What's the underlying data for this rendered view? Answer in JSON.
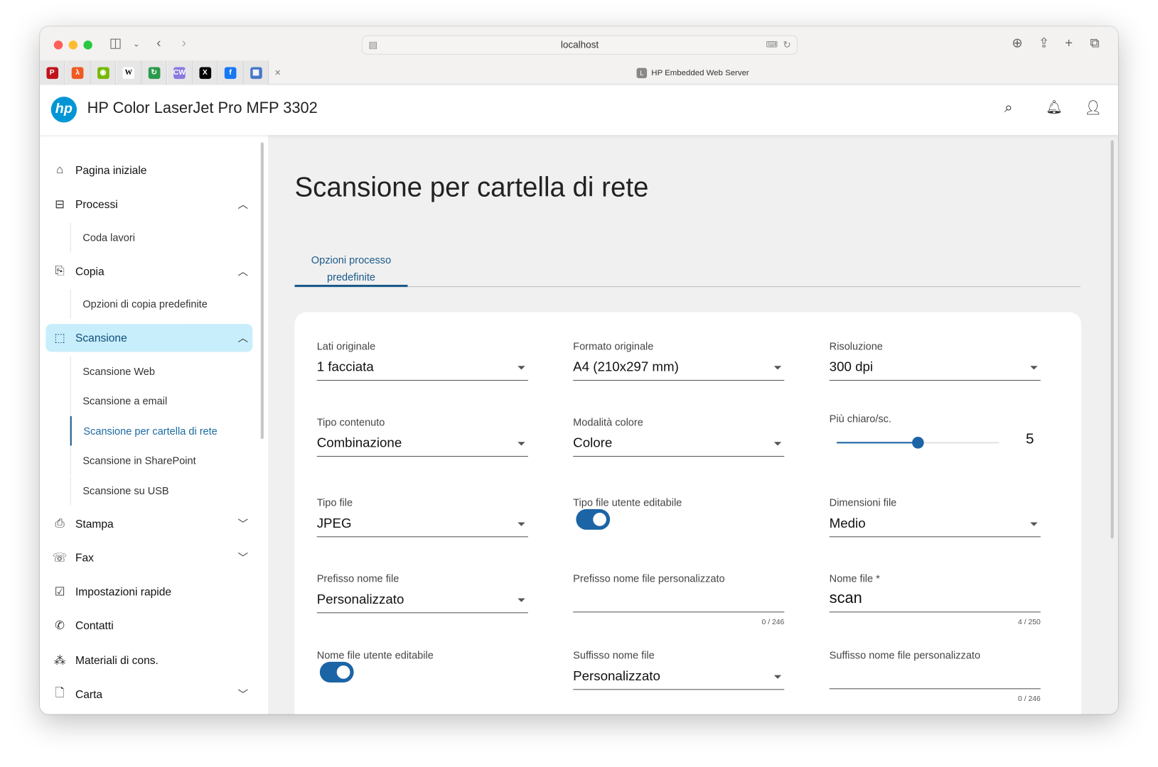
{
  "browser": {
    "url": "localhost",
    "tab_title": "HP Embedded Web Server",
    "tab_favicon_letter": "L",
    "close_label": "×",
    "favorites": [
      {
        "icon": "red-app-icon",
        "color": "#c0141c",
        "glyph": "P"
      },
      {
        "icon": "orange-app-icon",
        "color": "#f05a22",
        "glyph": "λ"
      },
      {
        "icon": "nvidia-icon",
        "color": "#76b900",
        "glyph": "◉"
      },
      {
        "icon": "wikipedia-icon",
        "color": "#ffffff",
        "glyph": "W"
      },
      {
        "icon": "green-red-app-icon",
        "color": "#2b9a4a",
        "glyph": "↻"
      },
      {
        "icon": "cw-icon",
        "color": "#8a7ae0",
        "glyph": "CW"
      },
      {
        "icon": "x-icon",
        "color": "#000000",
        "glyph": "X"
      },
      {
        "icon": "facebook-icon",
        "color": "#1877f2",
        "glyph": "f"
      },
      {
        "icon": "blue-grid-icon",
        "color": "#4a78c8",
        "glyph": "▦"
      }
    ]
  },
  "header": {
    "title": "HP Color LaserJet Pro MFP 3302",
    "logo_text": "hp"
  },
  "sidebar": {
    "home": "Pagina iniziale",
    "processi": "Processi",
    "coda": "Coda lavori",
    "copia": "Copia",
    "copia_opz": "Opzioni di copia predefinite",
    "scansione": "Scansione",
    "scan_items": [
      "Scansione Web",
      "Scansione a email",
      "Scansione per cartella di rete",
      "Scansione in SharePoint",
      "Scansione su USB"
    ],
    "stampa": "Stampa",
    "fax": "Fax",
    "impostazioni": "Impostazioni rapide",
    "contatti": "Contatti",
    "materiali": "Materiali di cons.",
    "carta": "Carta"
  },
  "main": {
    "title": "Scansione per cartella di rete",
    "tab_line1": "Opzioni processo",
    "tab_line2": "predefinite",
    "fields": {
      "lati": {
        "label": "Lati originale",
        "value": "1 facciata"
      },
      "formato": {
        "label": "Formato originale",
        "value": "A4 (210x297 mm)"
      },
      "risoluzione": {
        "label": "Risoluzione",
        "value": "300 dpi"
      },
      "tipo_contenuto": {
        "label": "Tipo contenuto",
        "value": "Combinazione"
      },
      "modalita": {
        "label": "Modalità colore",
        "value": "Colore"
      },
      "chiaro": {
        "label": "Più chiaro/sc.",
        "value": "5",
        "min": 1,
        "max": 9
      },
      "tipo_file": {
        "label": "Tipo file",
        "value": "JPEG"
      },
      "tipo_file_edit": {
        "label": "Tipo file utente editabile",
        "on": true
      },
      "dimensioni": {
        "label": "Dimensioni file",
        "value": "Medio"
      },
      "prefisso": {
        "label": "Prefisso nome file",
        "value": "Personalizzato"
      },
      "prefisso_pers": {
        "label": "Prefisso nome file personalizzato",
        "value": "",
        "counter": "0 / 246"
      },
      "nome_file": {
        "label": "Nome file *",
        "value": "scan",
        "counter": "4 / 250"
      },
      "nome_edit": {
        "label": "Nome file utente editabile",
        "on": true
      },
      "suffisso": {
        "label": "Suffisso nome file",
        "value": "Personalizzato"
      },
      "suffisso_pers": {
        "label": "Suffisso nome file personalizzato",
        "value": "",
        "counter": "0 / 246"
      }
    }
  },
  "colors": {
    "accent": "#1b64a6",
    "selected_bg": "#c8eefb"
  }
}
